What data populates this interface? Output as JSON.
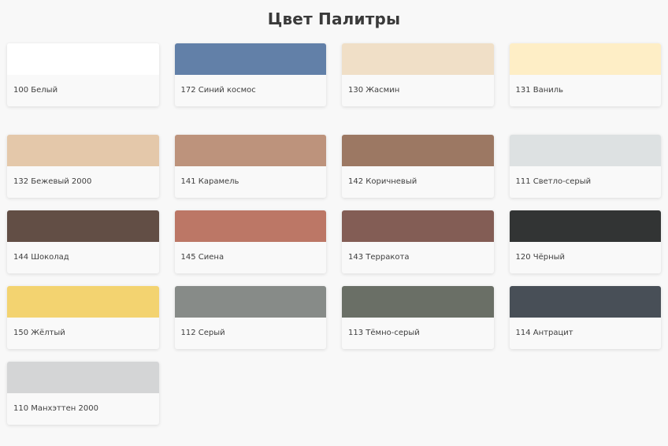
{
  "page_title": "Цвет Палитры",
  "rows": [
    [
      {
        "label": "100 Белый",
        "color": "#ffffff"
      },
      {
        "label": "172 Синий космос",
        "color": "#6280a8"
      },
      {
        "label": "130 Жасмин",
        "color": "#f0dfc7"
      },
      {
        "label": "131 Ваниль",
        "color": "#feeec6"
      }
    ],
    [
      {
        "label": "132 Бежевый 2000",
        "color": "#e4c8aa"
      },
      {
        "label": "141 Карамель",
        "color": "#bd937c"
      },
      {
        "label": "142 Коричневый",
        "color": "#9c7863"
      },
      {
        "label": "111 Светло-серый",
        "color": "#dde1e2"
      }
    ],
    [
      {
        "label": "144 Шоколад",
        "color": "#624e45"
      },
      {
        "label": "145 Сиена",
        "color": "#bc7766"
      },
      {
        "label": "143 Терракота",
        "color": "#835d55"
      },
      {
        "label": "120 Чёрный",
        "color": "#323434"
      }
    ],
    [
      {
        "label": "150 Жёлтый",
        "color": "#f3d370"
      },
      {
        "label": "112 Серый",
        "color": "#878b88"
      },
      {
        "label": "113 Тёмно-серый",
        "color": "#6a6f66"
      },
      {
        "label": "114 Антрацит",
        "color": "#484f57"
      }
    ],
    [
      {
        "label": "110 Манхэттен 2000",
        "color": "#d4d5d6"
      }
    ]
  ]
}
